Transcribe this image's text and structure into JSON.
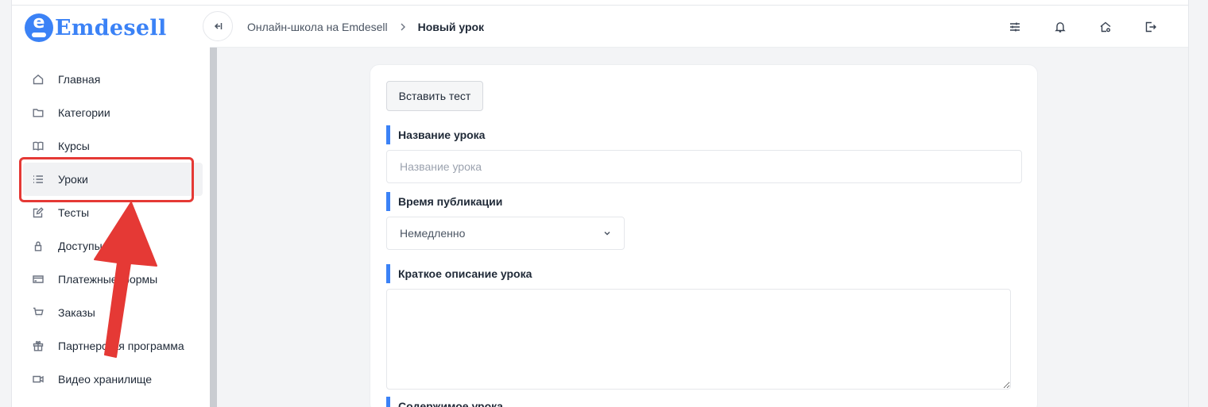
{
  "brand": {
    "name": "Emdesell",
    "color": "#3b82f6",
    "logo_glyph": "e"
  },
  "sidebar": {
    "items": [
      {
        "label": "Главная",
        "icon": "home-icon",
        "active": false
      },
      {
        "label": "Категории",
        "icon": "folder-icon",
        "active": false
      },
      {
        "label": "Курсы",
        "icon": "book-icon",
        "active": false
      },
      {
        "label": "Уроки",
        "icon": "list-icon",
        "active": true
      },
      {
        "label": "Тесты",
        "icon": "edit-icon",
        "active": false
      },
      {
        "label": "Доступы",
        "icon": "lock-icon",
        "active": false
      },
      {
        "label": "Платежные формы",
        "icon": "credit-card-icon",
        "active": false
      },
      {
        "label": "Заказы",
        "icon": "cart-icon",
        "active": false
      },
      {
        "label": "Партнерская программа",
        "icon": "gift-icon",
        "active": false
      },
      {
        "label": "Видео хранилище",
        "icon": "video-icon",
        "active": false
      }
    ]
  },
  "header": {
    "breadcrumb": {
      "parent": "Онлайн-школа на Emdesell",
      "current": "Новый урок"
    },
    "icons": [
      "settings-sliders-icon",
      "bell-icon",
      "home-settings-icon",
      "logout-icon"
    ]
  },
  "form": {
    "insert_test_label": "Вставить тест",
    "title_label": "Название урока",
    "title_placeholder": "Название урока",
    "publish_label": "Время публикации",
    "publish_value": "Немедленно",
    "short_desc_label": "Краткое описание урока",
    "content_label": "Содержимое урока"
  },
  "annotation": {
    "color": "#e53935",
    "highlighted_item": "Уроки"
  }
}
